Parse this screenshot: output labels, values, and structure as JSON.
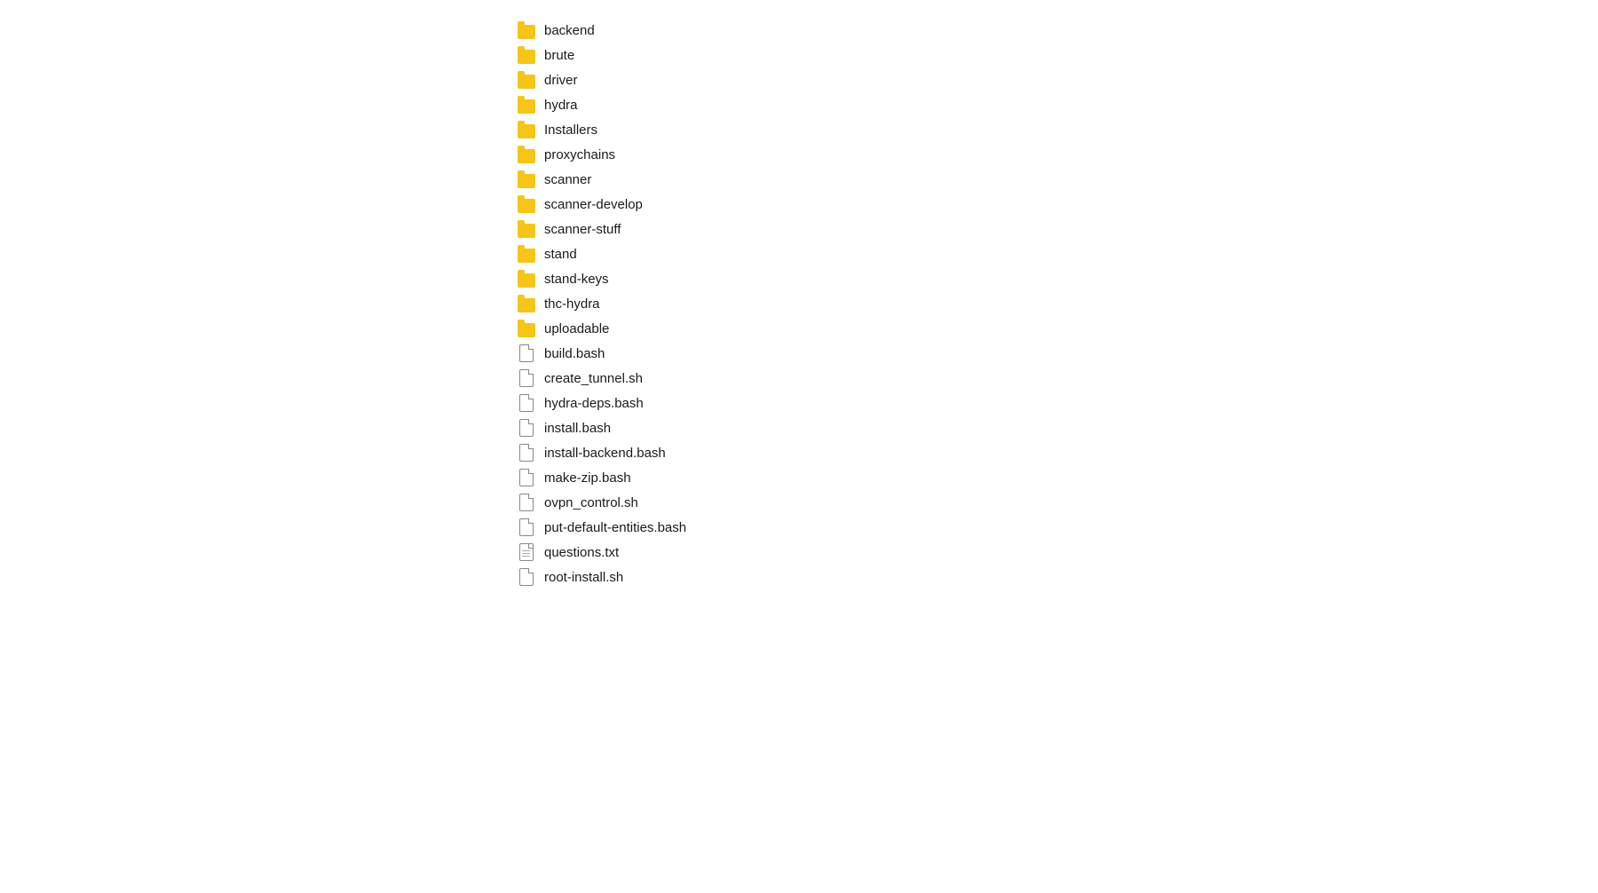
{
  "fileList": {
    "items": [
      {
        "name": "backend",
        "type": "folder"
      },
      {
        "name": "brute",
        "type": "folder"
      },
      {
        "name": "driver",
        "type": "folder"
      },
      {
        "name": "hydra",
        "type": "folder"
      },
      {
        "name": "Installers",
        "type": "folder"
      },
      {
        "name": "proxychains",
        "type": "folder"
      },
      {
        "name": "scanner",
        "type": "folder"
      },
      {
        "name": "scanner-develop",
        "type": "folder"
      },
      {
        "name": "scanner-stuff",
        "type": "folder"
      },
      {
        "name": "stand",
        "type": "folder"
      },
      {
        "name": "stand-keys",
        "type": "folder"
      },
      {
        "name": "thc-hydra",
        "type": "folder"
      },
      {
        "name": "uploadable",
        "type": "folder"
      },
      {
        "name": "build.bash",
        "type": "file"
      },
      {
        "name": "create_tunnel.sh",
        "type": "file"
      },
      {
        "name": "hydra-deps.bash",
        "type": "file"
      },
      {
        "name": "install.bash",
        "type": "file"
      },
      {
        "name": "install-backend.bash",
        "type": "file"
      },
      {
        "name": "make-zip.bash",
        "type": "file"
      },
      {
        "name": "ovpn_control.sh",
        "type": "file"
      },
      {
        "name": "put-default-entities.bash",
        "type": "file"
      },
      {
        "name": "questions.txt",
        "type": "textfile"
      },
      {
        "name": "root-install.sh",
        "type": "file"
      }
    ]
  }
}
